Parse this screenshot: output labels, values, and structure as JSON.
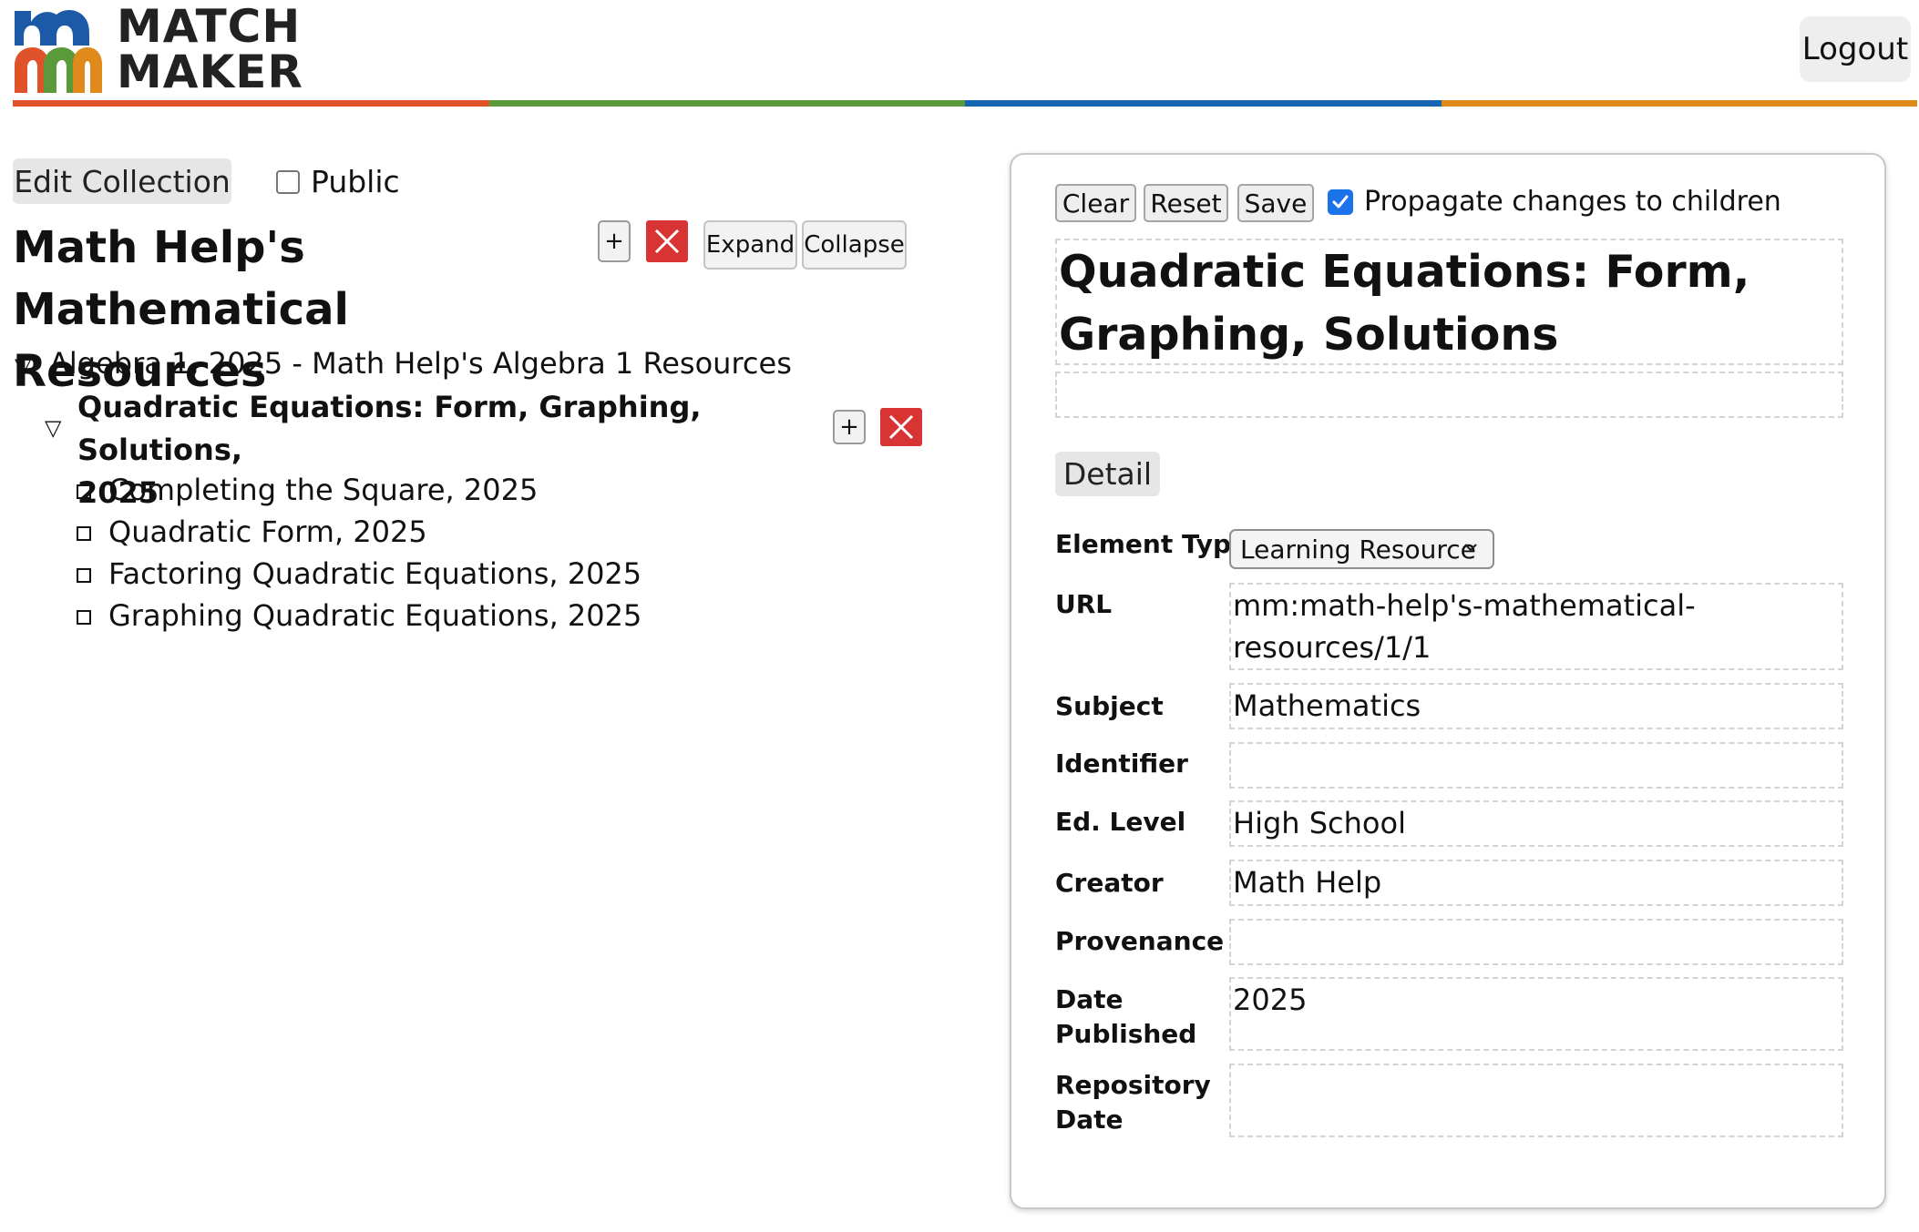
{
  "header": {
    "logo": {
      "line1": "MATCH",
      "line2": "MAKER"
    },
    "logout_label": "Logout",
    "stripe_colors": [
      "#e0532a",
      "#5a9a3b",
      "#1565b0",
      "#e08a1c"
    ]
  },
  "left": {
    "edit_collection_label": "Edit Collection",
    "public_label": "Public",
    "public_checked": false,
    "collection_title_line1": "Math Help's",
    "collection_title_line2": "Mathematical Resources",
    "add_label": "+",
    "expand_label": "Expand",
    "collapse_label": "Collapse",
    "tree": {
      "root": "Algebra 1, 2025 - Math Help's Algebra 1 Resources",
      "selected_line1": "Quadratic Equations: Form, Graphing, Solutions,",
      "selected_line2": "2025",
      "children": [
        "Completing the Square, 2025",
        "Quadratic Form, 2025",
        "Factoring Quadratic Equations, 2025",
        "Graphing Quadratic Equations, 2025"
      ]
    }
  },
  "editor": {
    "clear_label": "Clear",
    "reset_label": "Reset",
    "save_label": "Save",
    "propagate_label": "Propagate changes to children",
    "propagate_checked": true,
    "title_line1": "Quadratic Equations: Form,",
    "title_line2": "Graphing, Solutions",
    "description": "",
    "detail_tab_label": "Detail",
    "fields": {
      "element_type": {
        "label": "Element Type",
        "value": "Learning Resource"
      },
      "url": {
        "label": "URL",
        "value_line1": "mm:math-help's-mathematical-",
        "value_line2": "resources/1/1"
      },
      "subject": {
        "label": "Subject",
        "value": "Mathematics"
      },
      "identifier": {
        "label": "Identifier",
        "value": ""
      },
      "ed_level": {
        "label": "Ed. Level",
        "value": "High School"
      },
      "creator": {
        "label": "Creator",
        "value": "Math Help"
      },
      "provenance": {
        "label": "Provenance",
        "value": ""
      },
      "date_published": {
        "label_line1": "Date",
        "label_line2": "Published",
        "value": "2025"
      },
      "repository_date": {
        "label_line1": "Repository",
        "label_line2": "Date",
        "value": ""
      }
    }
  }
}
